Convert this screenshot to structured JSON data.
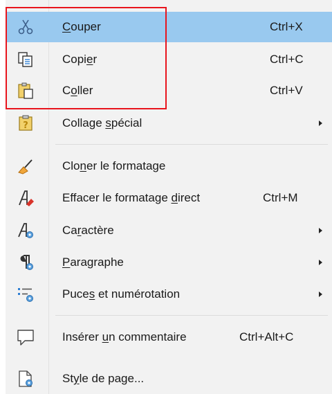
{
  "menu": {
    "items": [
      {
        "id": "couper",
        "pre": "",
        "acc": "C",
        "post": "ouper",
        "shortcut": "Ctrl+X",
        "icon": "scissors-icon"
      },
      {
        "id": "copier",
        "pre": "Copi",
        "acc": "e",
        "post": "r",
        "shortcut": "Ctrl+C",
        "icon": "copy-icon"
      },
      {
        "id": "coller",
        "pre": "C",
        "acc": "o",
        "post": "ller",
        "shortcut": "Ctrl+V",
        "icon": "paste-icon"
      },
      {
        "id": "collage-special",
        "pre": "Collage ",
        "acc": "s",
        "post": "pécial",
        "shortcut": "",
        "icon": "paste-special-icon"
      },
      {
        "id": "cloner",
        "pre": "Clo",
        "acc": "n",
        "post": "er le formatage",
        "shortcut": "",
        "icon": "clone-formatting-icon"
      },
      {
        "id": "effacer",
        "pre": "Effacer le formatage ",
        "acc": "d",
        "post": "irect",
        "shortcut": "Ctrl+M",
        "icon": "clear-formatting-icon"
      },
      {
        "id": "caractere",
        "pre": "Ca",
        "acc": "r",
        "post": "actère",
        "shortcut": "",
        "icon": "character-icon"
      },
      {
        "id": "paragraphe",
        "pre": "",
        "acc": "P",
        "post": "aragraphe",
        "shortcut": "",
        "icon": "paragraph-icon"
      },
      {
        "id": "puces",
        "pre": "Puce",
        "acc": "s",
        "post": " et numérotation",
        "shortcut": "",
        "icon": "bullets-icon"
      },
      {
        "id": "inserer-commentaire",
        "pre": "Insérer ",
        "acc": "u",
        "post": "n commentaire",
        "shortcut": "Ctrl+Alt+C",
        "icon": "comment-icon"
      },
      {
        "id": "style-page",
        "pre": "St",
        "acc": "y",
        "post": "le de page...",
        "shortcut": "",
        "icon": "page-style-icon"
      }
    ]
  },
  "colors": {
    "highlight": "#99c9ef",
    "annotation_box": "#e8141c"
  }
}
